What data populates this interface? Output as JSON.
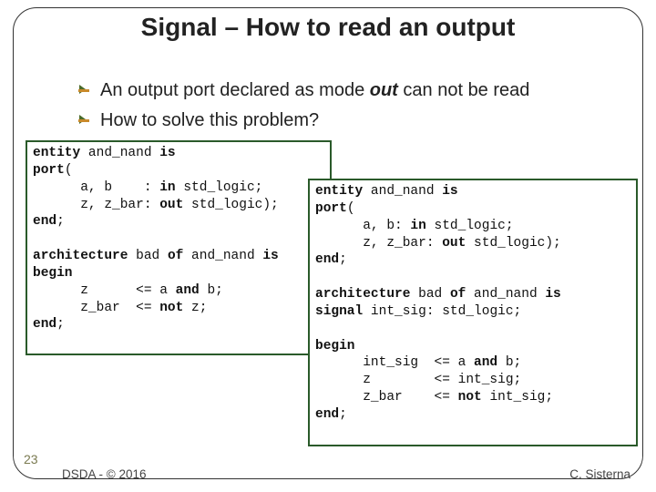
{
  "title": "Signal – How to read an output",
  "bullets": {
    "b1_pre": "An output port declared as mode ",
    "b1_kw": "out",
    "b1_post": " can not be read",
    "b2": "How to solve this problem?"
  },
  "code_left": "entity and_nand is\nport(\n      a, b    : in std_logic;\n      z, z_bar: out std_logic);\nend;\n\narchitecture bad of and_nand is\nbegin\n      z      <= a and b;\n      z_bar  <= not z;\nend;",
  "code_right": "entity and_nand is\nport(\n      a, b: in std_logic;\n      z, z_bar: out std_logic);\nend;\n\narchitecture bad of and_nand is\nsignal int_sig: std_logic;\n\nbegin\n      int_sig  <= a and b;\n      z        <= int_sig;\n      z_bar    <= not int_sig;\nend;",
  "page_number": "23",
  "footer_left": "DSDA - © 2016",
  "footer_right": "C. Sisterna",
  "keywords": [
    "entity",
    "is",
    "port",
    "in",
    "out",
    "end",
    "architecture",
    "of",
    "begin",
    "and",
    "not",
    "signal"
  ]
}
